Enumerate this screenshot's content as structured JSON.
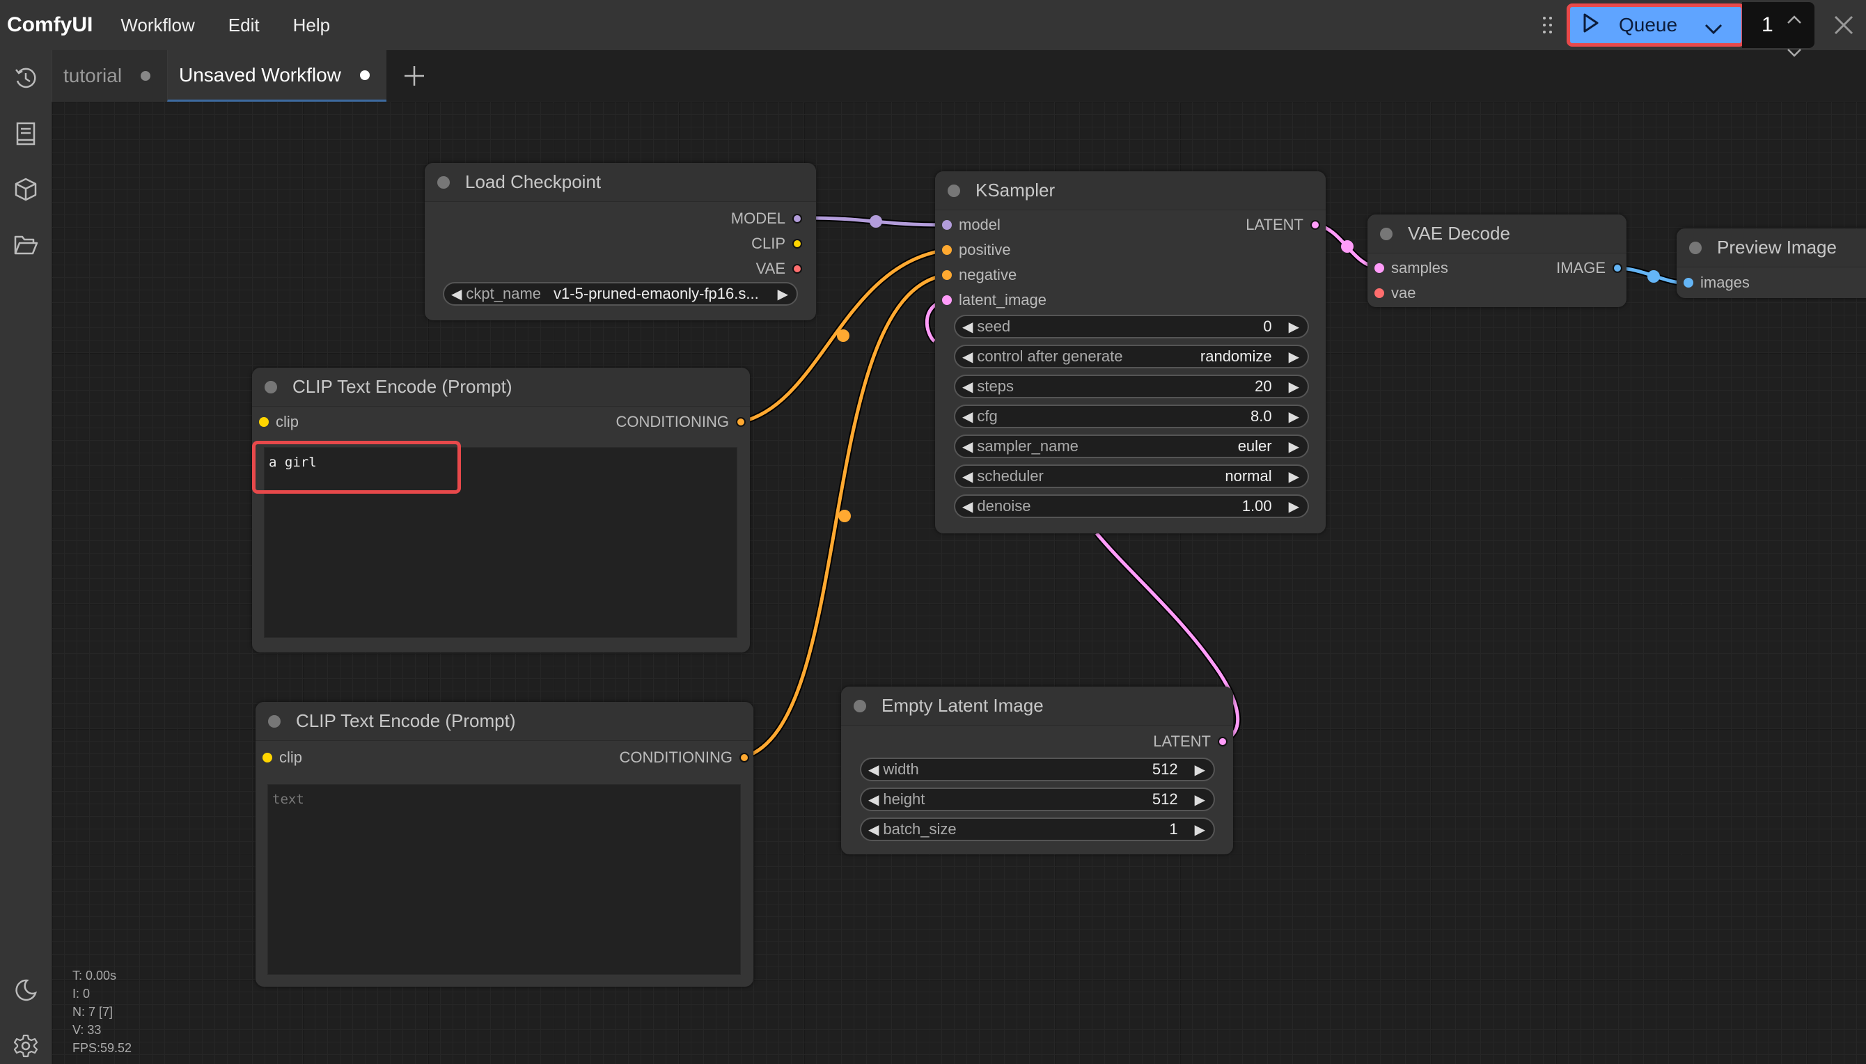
{
  "app": {
    "title": "ComfyUI"
  },
  "menu": [
    "Workflow",
    "Edit",
    "Help"
  ],
  "toolbar": {
    "queue_label": "Queue",
    "batch_count": "1"
  },
  "tabs": [
    {
      "label": "tutorial",
      "active": false,
      "unsaved": true
    },
    {
      "label": "Unsaved Workflow",
      "active": true,
      "unsaved": true
    }
  ],
  "sidebar": {
    "top_icons": [
      "history-icon",
      "node-library-icon",
      "model-library-icon",
      "workflows-icon"
    ],
    "bottom_icons": [
      "theme-toggle-icon",
      "settings-icon"
    ]
  },
  "colors": {
    "model": "#b39ddb",
    "clip": "#ffd500",
    "vae": "#ff6e6e",
    "conditioning": "#ffa931",
    "latent": "#ff9cf9",
    "image": "#64b5f6",
    "queue_bg": "#5fa4ff",
    "highlight": "#e8494b"
  },
  "nodes": {
    "load_checkpoint": {
      "title": "Load Checkpoint",
      "outputs": [
        "MODEL",
        "CLIP",
        "VAE"
      ],
      "widgets": [
        {
          "label": "ckpt_name",
          "value": "v1-5-pruned-emaonly-fp16.s..."
        }
      ]
    },
    "ksampler": {
      "title": "KSampler",
      "inputs": [
        "model",
        "positive",
        "negative",
        "latent_image"
      ],
      "outputs": [
        "LATENT"
      ],
      "widgets": [
        {
          "label": "seed",
          "value": "0"
        },
        {
          "label": "control after generate",
          "value": "randomize"
        },
        {
          "label": "steps",
          "value": "20"
        },
        {
          "label": "cfg",
          "value": "8.0"
        },
        {
          "label": "sampler_name",
          "value": "euler"
        },
        {
          "label": "scheduler",
          "value": "normal"
        },
        {
          "label": "denoise",
          "value": "1.00"
        }
      ]
    },
    "vae_decode": {
      "title": "VAE Decode",
      "inputs": [
        "samples",
        "vae"
      ],
      "outputs": [
        "IMAGE"
      ]
    },
    "preview_image": {
      "title": "Preview Image",
      "inputs": [
        "images"
      ]
    },
    "clip_text_positive": {
      "title": "CLIP Text Encode (Prompt)",
      "inputs": [
        "clip"
      ],
      "outputs": [
        "CONDITIONING"
      ],
      "text": "a girl",
      "placeholder": "text"
    },
    "clip_text_negative": {
      "title": "CLIP Text Encode (Prompt)",
      "inputs": [
        "clip"
      ],
      "outputs": [
        "CONDITIONING"
      ],
      "text": "",
      "placeholder": "text"
    },
    "empty_latent": {
      "title": "Empty Latent Image",
      "outputs": [
        "LATENT"
      ],
      "widgets": [
        {
          "label": "width",
          "value": "512"
        },
        {
          "label": "height",
          "value": "512"
        },
        {
          "label": "batch_size",
          "value": "1"
        }
      ]
    }
  },
  "stats": {
    "time": "T: 0.00s",
    "iterations": "I: 0",
    "nodes": "N: 7 [7]",
    "vertices": "V: 33",
    "fps": "FPS:59.52"
  }
}
